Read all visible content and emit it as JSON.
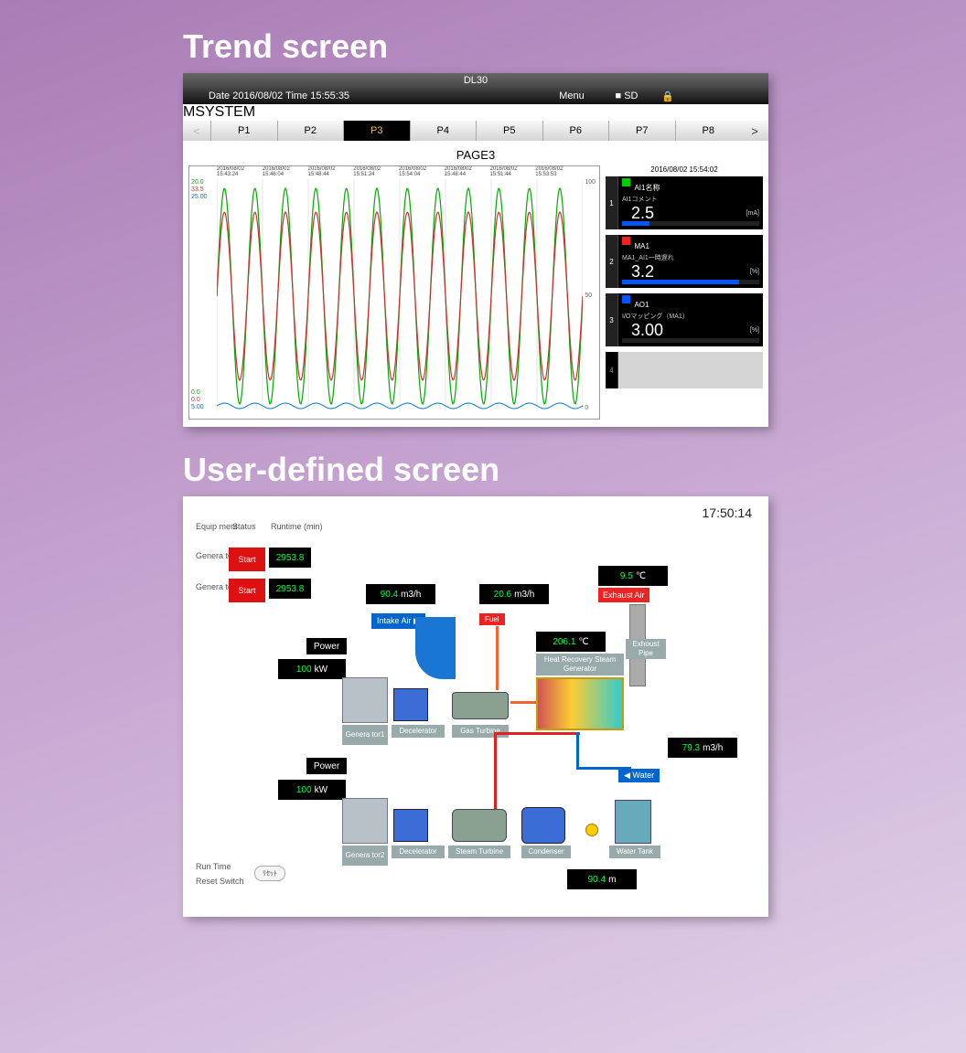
{
  "titles": {
    "trend": "Trend screen",
    "uds": "User-defined screen"
  },
  "trend": {
    "device": "DL30",
    "datetime": "Date 2016/08/02 Time 15:55:35",
    "menu": "Menu",
    "sd": "SD",
    "brand": "MSYSTEM",
    "tabs": [
      "P1",
      "P2",
      "P3",
      "P4",
      "P5",
      "P6",
      "P7",
      "P8"
    ],
    "active_tab": "P3",
    "page_title": "PAGE3",
    "side_time": "2016/08/02 15:54:02",
    "ytop": {
      "g": "20.0",
      "r": "33.5",
      "b": "25.00"
    },
    "ybot": {
      "g": "0.0",
      "r": "0.0",
      "b": "5.00"
    },
    "time_labels": [
      "2016/08/02 15:43:24",
      "2016/08/02 15:46:04",
      "2016/08/02 15:48:44",
      "2016/08/02 15:51:24",
      "2016/08/02 15:54:04",
      "2016/08/02 15:48:44",
      "2016/08/02 15:51:44",
      "2016/08/02 15:53:53"
    ],
    "cards": [
      {
        "num": "1",
        "color": "#0c0",
        "name": "AI1名称",
        "sub": "AI1コメント",
        "val": "2.5",
        "unit": "[mA]",
        "fill": 20
      },
      {
        "num": "2",
        "color": "#e22",
        "name": "MA1",
        "sub": "MA1_AI1一時遅れ",
        "val": "3.2",
        "unit": "[%]",
        "fill": 85
      },
      {
        "num": "3",
        "color": "#05f",
        "name": "AO1",
        "sub": "I/Oマッピング（MA1）",
        "val": "3.00",
        "unit": "[%]",
        "fill": 0
      },
      {
        "num": "4",
        "empty": true
      }
    ]
  },
  "chart_data": {
    "type": "line",
    "title": "PAGE3",
    "xlabel": "",
    "ylabel": "",
    "x_range_minutes": [
      "15:43:24",
      "15:55:35"
    ],
    "series": [
      {
        "name": "AI1 (green)",
        "color": "#0a0",
        "period_s": 55,
        "amplitude": 10,
        "offset": 10,
        "range": [
          0,
          20
        ]
      },
      {
        "name": "MA1 (red)",
        "color": "#c33",
        "period_s": 55,
        "amplitude": 15,
        "offset": 17,
        "range": [
          0,
          33.5
        ]
      },
      {
        "name": "AO1 (blue)",
        "color": "#07c",
        "period_s": 55,
        "amplitude": 0.3,
        "offset": 5.15,
        "range": [
          5,
          25
        ],
        "note": "nearly constant low"
      }
    ],
    "right_axis_ticks": [
      100,
      50,
      0
    ]
  },
  "uds": {
    "time": "17:50:14",
    "hdr_equip": "Equip\nment",
    "hdr_status": "Status",
    "hdr_runtime": "Runtime\n(min)",
    "gen1": "Genera\ntor1",
    "gen2": "Genera\ntor1",
    "start": "Start",
    "rt1": "2953.8",
    "rt2": "2953.8",
    "power": "Power",
    "p_kw": "100",
    "kw": "kW",
    "intake": "Intake Air",
    "fuel": "Fuel",
    "exhaust_air": "Exhaust Air",
    "water": "Water",
    "v_flow1": "90.4",
    "v_flow1u": "m3/h",
    "v_flow2": "20.6",
    "v_flow2u": "m3/h",
    "v_temp1": "9.5",
    "v_temp1u": "℃",
    "v_temp2": "206.1",
    "v_temp2u": "℃",
    "v_flow3": "79.3",
    "v_flow3u": "m3/h",
    "v_last": "90.4",
    "v_lastu": "m",
    "hrsg": "Heat Recovery\nSteam Generator",
    "exh_pipe": "Exhoust\nPipe",
    "decelerator": "Decelerator",
    "gas_turbine": "Gas Turbine",
    "steam_turbine": "Steam Turbine",
    "condenser": "Condenser",
    "water_tank": "Water Tank",
    "genlbl1": "Genera\ntor1",
    "genlbl2": "Genera\ntor2",
    "run_time": "Run Time",
    "reset_switch": "Reset Switch",
    "reset_btn": "ﾘｾｯﾄ"
  }
}
